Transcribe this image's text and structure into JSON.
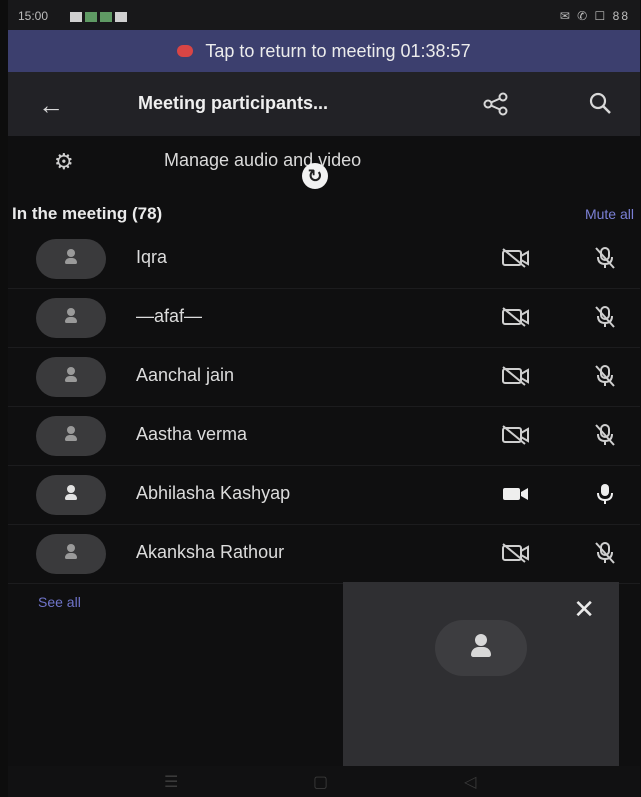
{
  "status_bar": {
    "time": "15:00",
    "left_icons": "all",
    "right_icons": "✉ ✆ ☐ 88"
  },
  "banner": {
    "text": "Tap to return to meeting 01:38:57"
  },
  "header": {
    "title": "Meeting participants..."
  },
  "manage": {
    "label": "Manage audio and video"
  },
  "section": {
    "heading": "In the meeting (78)",
    "mute_all": "Mute all"
  },
  "participants": [
    {
      "name": "Iqra",
      "camera": "off",
      "mic": "off"
    },
    {
      "name": "—afaf—",
      "camera": "off",
      "mic": "off"
    },
    {
      "name": "Aanchal jain",
      "camera": "off",
      "mic": "off"
    },
    {
      "name": "Aastha verma",
      "camera": "off",
      "mic": "off"
    },
    {
      "name": "Abhilasha Kashyap",
      "camera": "on",
      "mic": "on"
    },
    {
      "name": "Akanksha Rathour",
      "camera": "off",
      "mic": "off"
    }
  ],
  "see_all": "See all",
  "colors": {
    "banner_bg": "#3c3f6e",
    "accent": "#7b80d6",
    "live_dot": "#d94545"
  }
}
